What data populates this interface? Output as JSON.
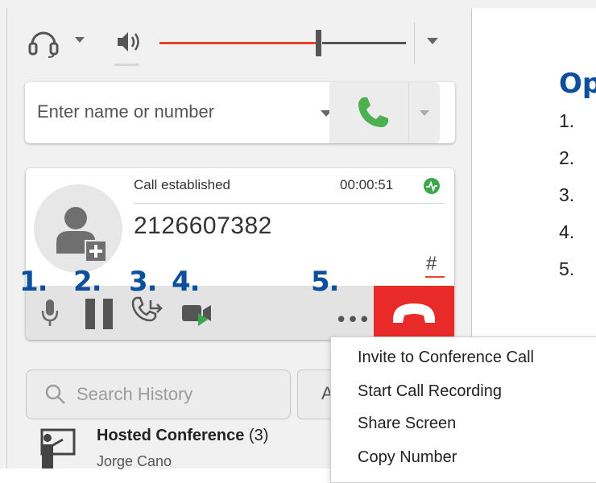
{
  "audio": {
    "headset_icon": "headset-icon",
    "speaker_icon": "speaker-icon",
    "volume_level": 0.6
  },
  "dialer": {
    "placeholder": "Enter name or number",
    "call_icon": "phone-icon"
  },
  "call": {
    "status": "Call established",
    "duration": "00:00:51",
    "number": "2126607382",
    "keypad_label": "#"
  },
  "toolbar": {
    "more_label": "•••",
    "icons": [
      "microphone-icon",
      "pause-icon",
      "transfer-icon",
      "video-icon",
      "more-icon",
      "hangup-icon"
    ]
  },
  "labels": {
    "one": "1.",
    "two": "2.",
    "three": "3.",
    "four": "4.",
    "five": "5."
  },
  "context_menu": {
    "items": [
      "Invite to Conference Call",
      "Start Call Recording",
      "Share Screen",
      "Copy Number"
    ]
  },
  "history": {
    "search_placeholder": "Search History",
    "filter_label": "A",
    "items": [
      {
        "title": "Hosted Conference",
        "count": "(3)",
        "subtitle": "Jorge Cano"
      }
    ]
  },
  "doc": {
    "heading": "Op",
    "numbers": [
      "1.",
      "2.",
      "3.",
      "4.",
      "5."
    ]
  },
  "colors": {
    "accent_blue": "#0c4f9c",
    "hangup_red": "#e82a28",
    "call_green": "#4caf50",
    "volume_red": "#e8412c"
  }
}
